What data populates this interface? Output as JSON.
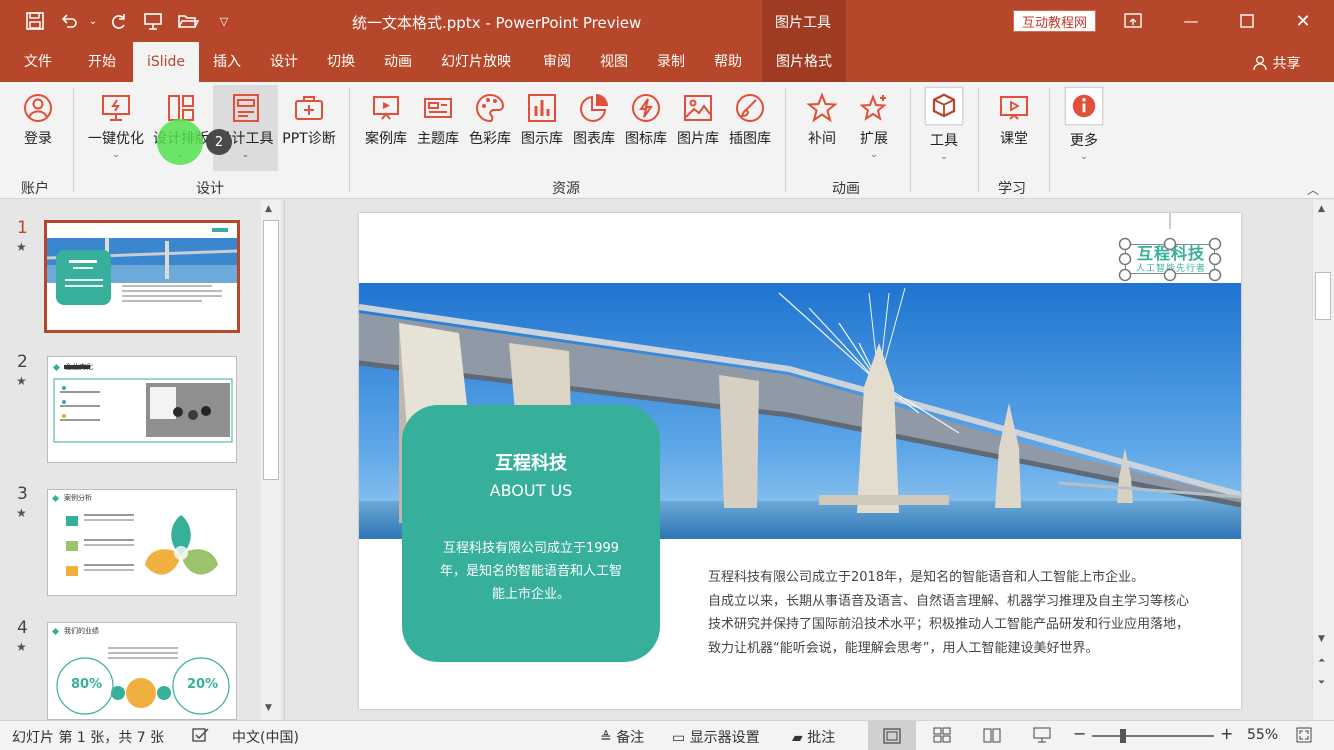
{
  "titlebar": {
    "document_title": "统一文本格式.pptx - PowerPoint Preview",
    "contextual_group": "图片工具",
    "brand_badge": "互动教程网",
    "icons": [
      "save-icon",
      "undo-icon",
      "redo-icon",
      "present-icon",
      "open-folder-icon",
      "customize-icon"
    ]
  },
  "tabs": [
    {
      "label": "文件"
    },
    {
      "label": "开始"
    },
    {
      "label": "iSlide"
    },
    {
      "label": "插入"
    },
    {
      "label": "设计"
    },
    {
      "label": "切换"
    },
    {
      "label": "动画"
    },
    {
      "label": "幻灯片放映"
    },
    {
      "label": "审阅"
    },
    {
      "label": "视图"
    },
    {
      "label": "录制"
    },
    {
      "label": "帮助"
    },
    {
      "label": "图片格式"
    }
  ],
  "share_label": "共享",
  "ribbon": {
    "buttons": {
      "login": "登录",
      "one_click": "一键优化",
      "design_layout": "设计排版",
      "design_tools": "设计工具",
      "ppt_diag": "PPT诊断",
      "cases": "案例库",
      "themes": "主题库",
      "colors": "色彩库",
      "diagrams": "图示库",
      "charts": "图表库",
      "icons": "图标库",
      "pictures": "图片库",
      "illustrations": "插图库",
      "tween": "补间",
      "extend": "扩展",
      "tools": "工具",
      "classroom": "课堂",
      "more": "更多"
    },
    "groups": {
      "account": "账户",
      "design": "设计",
      "resources": "资源",
      "animation": "动画",
      "learning": "学习"
    },
    "step_badge": "2"
  },
  "slides": [
    {
      "number": "1",
      "title": "互程科技",
      "subtitle": "ABOUT US"
    },
    {
      "number": "2",
      "title": "企业文化"
    },
    {
      "number": "3",
      "title": "案例分析"
    },
    {
      "number": "4",
      "title": "我们的业绩",
      "stat_left": "80%",
      "stat_right": "20%"
    }
  ],
  "slide": {
    "logo_title": "互程科技",
    "logo_subtitle": "人工智能先行者",
    "card_title": "互程科技",
    "card_subtitle": "ABOUT US",
    "card_body": "互程科技有限公司成立于1999年，是知名的智能语音和人工智能上市企业。",
    "body_lines": [
      "互程科技有限公司成立于2018年，是知名的智能语音和人工智能上市企业。",
      "自成立以来，长期从事语音及语言、自然语言理解、机器学习推理及自主学习等核心",
      "技术研究并保持了国际前沿技术水平；积极推动人工智能产品研发和行业应用落地，",
      "致力让机器“能听会说，能理解会思考”，用人工智能建设美好世界。"
    ],
    "accent_color": "#36b09a"
  },
  "statusbar": {
    "slide_counter": "幻灯片 第 1 张，共 7 张",
    "language": "中文(中国)",
    "notes": "备注",
    "display_settings": "显示器设置",
    "comments": "批注",
    "zoom": "55%"
  },
  "colors": {
    "brand": "#b7472a",
    "ribbon_icon": "#e0503a"
  }
}
